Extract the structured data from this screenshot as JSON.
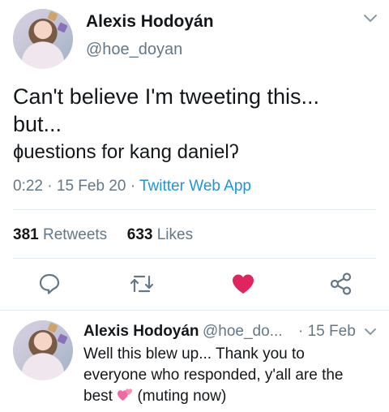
{
  "tweet": {
    "author_name": "Alexis Hodoyán",
    "author_handle": "@hoe_doyan",
    "text_line1": "Can't believe I'm tweeting this...",
    "text_line2": "but...",
    "text_line3": "ɸuestions for kang danielʔ",
    "time": "0:22",
    "date": "15 Feb 20",
    "source": "Twitter Web App",
    "retweets_count": "381",
    "retweets_label": "Retweets",
    "likes_count": "633",
    "likes_label": "Likes"
  },
  "icons": {
    "chevron": "chevron-down-icon",
    "reply": "reply-icon",
    "retweet": "retweet-icon",
    "like": "heart-icon",
    "share": "share-icon",
    "like_color": "#e0245e",
    "accent": "#1b95e0"
  },
  "reply": {
    "author_name": "Alexis Hodoyán",
    "author_handle": "@hoe_do...",
    "date": "15 Feb",
    "text_line1": "Well this blew up... Thank you to",
    "text_line2": "everyone who responded, y'all are the",
    "text_before_emoji": "best",
    "text_after_emoji": "(muting now)"
  }
}
